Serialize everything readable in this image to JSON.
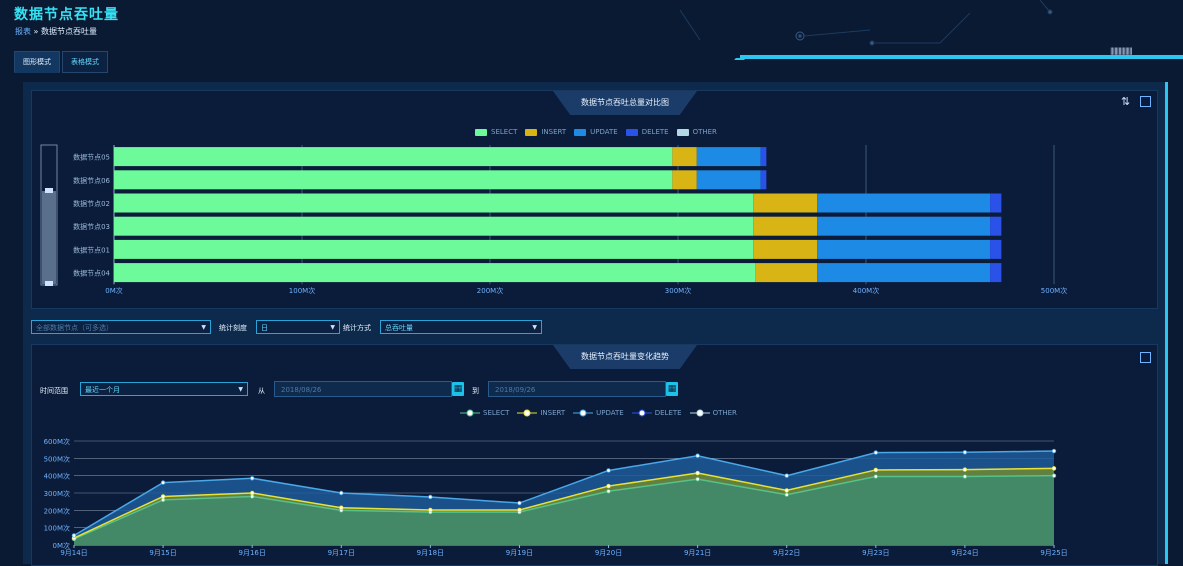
{
  "page": {
    "title": "数据节点吞吐量",
    "breadcrumb_root": "报表",
    "breadcrumb_sep": "»",
    "breadcrumb_current": "数据节点吞吐量",
    "header_badge": "||||||||||||||||"
  },
  "tabs": [
    {
      "label": "图形模式",
      "active": true
    },
    {
      "label": "表格模式",
      "active": false
    }
  ],
  "bar_panel": {
    "title": "数据节点吞吐总量对比图",
    "legend": [
      {
        "name": "SELECT",
        "color": "#6cfa9a"
      },
      {
        "name": "INSERT",
        "color": "#d9b415"
      },
      {
        "name": "UPDATE",
        "color": "#1d8ae6"
      },
      {
        "name": "DELETE",
        "color": "#2a52e8"
      },
      {
        "name": "OTHER",
        "color": "#b5d8e6"
      }
    ],
    "icons": [
      "sort-icon",
      "fullscreen-icon"
    ]
  },
  "filters": {
    "node_select": "全部数据节点（可多选）",
    "granularity_label": "统计刻度",
    "granularity_value": "日",
    "method_label": "统计方式",
    "method_value": "总吞吐量"
  },
  "line_panel": {
    "title": "数据节点吞吐量变化趋势",
    "range_label": "时间范围",
    "range_value": "最近一个月",
    "from_label": "从",
    "from_date": "2018/08/26",
    "to_label": "到",
    "to_date": "2018/09/26"
  },
  "chart_data": [
    {
      "type": "bar",
      "orientation": "horizontal",
      "stacked": true,
      "title": "数据节点吞吐总量对比图",
      "categories": [
        "数据节点05",
        "数据节点06",
        "数据节点02",
        "数据节点03",
        "数据节点01",
        "数据节点04"
      ],
      "series": [
        {
          "name": "SELECT",
          "values": [
            297,
            297,
            340,
            340,
            340,
            341
          ]
        },
        {
          "name": "INSERT",
          "values": [
            13,
            13,
            34,
            34,
            34,
            33
          ]
        },
        {
          "name": "UPDATE",
          "values": [
            34,
            34,
            92,
            92,
            92,
            92
          ]
        },
        {
          "name": "DELETE",
          "values": [
            3,
            3,
            6,
            6,
            6,
            6
          ]
        },
        {
          "name": "OTHER",
          "values": [
            0,
            0,
            0,
            0,
            0,
            0
          ]
        }
      ],
      "xlim": [
        0,
        500
      ],
      "x_ticks": [
        "0M次",
        "100M次",
        "200M次",
        "300M次",
        "400M次",
        "500M次"
      ],
      "legend_position": "top-center"
    },
    {
      "type": "area",
      "stacked": true,
      "title": "数据节点吞吐量变化趋势",
      "x": [
        "9月14日",
        "9月15日",
        "9月16日",
        "9月17日",
        "9月18日",
        "9月19日",
        "9月20日",
        "9月21日",
        "9月22日",
        "9月23日",
        "9月24日",
        "9月25日"
      ],
      "series": [
        {
          "name": "SELECT",
          "color": "#56c28a",
          "values": [
            35,
            260,
            280,
            200,
            190,
            190,
            310,
            380,
            290,
            395,
            395,
            400
          ]
        },
        {
          "name": "INSERT",
          "color": "#e6e23a",
          "values": [
            5,
            20,
            20,
            15,
            12,
            12,
            30,
            35,
            25,
            38,
            40,
            42
          ]
        },
        {
          "name": "UPDATE",
          "color": "#4aa7e8",
          "values": [
            15,
            80,
            85,
            85,
            75,
            40,
            90,
            100,
            85,
            100,
            100,
            100
          ]
        },
        {
          "name": "DELETE",
          "color": "#2a52e8",
          "values": [
            0,
            0,
            0,
            0,
            0,
            0,
            0,
            0,
            0,
            0,
            0,
            0
          ]
        },
        {
          "name": "OTHER",
          "color": "#b5d8e6",
          "values": [
            0,
            0,
            0,
            0,
            0,
            0,
            0,
            0,
            0,
            0,
            0,
            0
          ]
        }
      ],
      "ylim": [
        0,
        600
      ],
      "y_ticks": [
        "0M次",
        "100M次",
        "200M次",
        "300M次",
        "400M次",
        "500M次",
        "600M次"
      ],
      "legend_position": "top-center"
    }
  ]
}
